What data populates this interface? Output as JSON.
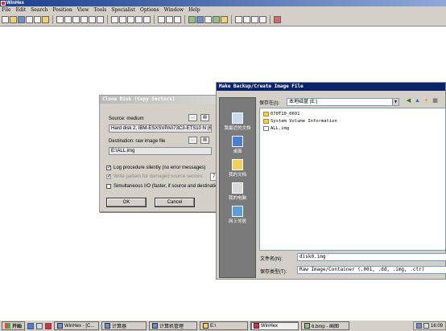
{
  "app": {
    "title": "WinHex"
  },
  "menu": [
    "File",
    "Edit",
    "Search",
    "Position",
    "View",
    "Tools",
    "Specialist",
    "Options",
    "Window",
    "Help"
  ],
  "toolbar_icons": [
    "new-icon",
    "open-icon",
    "save-icon",
    "print-icon",
    "properties-icon",
    "open-folder-icon",
    "undo-icon",
    "cut-icon",
    "copy-icon",
    "paste-icon",
    "paste-special-icon",
    "write-icon",
    "find-icon",
    "find-replace-icon",
    "find-hex-icon",
    "replace-hex-icon",
    "find-integer-icon",
    "goto-offset-icon",
    "back-icon",
    "forward-icon",
    "disk-editor-icon",
    "ram-editor-icon",
    "calculator-icon",
    "hash-icon",
    "data-interpreter-icon",
    "first-sector-icon",
    "previous-sector-icon",
    "next-sector-icon",
    "last-sector-icon",
    "options-icon"
  ],
  "clone_dialog": {
    "title": "Clone Disk (Copy Sectors)",
    "source_label": "Source: medium",
    "source_value": "Hard disk 2, IBM-ESXSVPA073C3-ETS10 N (68.",
    "destination_label": "Destination: raw image file",
    "destination_value": "E:\\ALL.img",
    "log_label": "Log procedure silently (no error messages)",
    "log_checked": true,
    "pattern_label": "Write pattern for damaged source sectors:",
    "pattern_value": "7",
    "pattern_checked": true,
    "simultaneous_label": "Simultaneous I/O (faster, if source and destination",
    "simultaneous_checked": false,
    "ok_label": "OK",
    "cancel_label": "Cancel"
  },
  "save_dialog": {
    "title": "Make Backup/Create Image File",
    "save_in_label": "保存在(I):",
    "save_in_value": "本地磁盘 (E:)",
    "places": [
      {
        "label": "我最近的文档",
        "icon": "recent-documents-icon"
      },
      {
        "label": "桌面",
        "icon": "desktop-icon"
      },
      {
        "label": "我的文档",
        "icon": "my-documents-icon"
      },
      {
        "label": "我的电脑",
        "icon": "my-computer-icon"
      },
      {
        "label": "网上邻居",
        "icon": "network-places-icon"
      }
    ],
    "files": [
      {
        "name": "070T10_0691",
        "type": "folder"
      },
      {
        "name": "System Volume Information",
        "type": "folder"
      },
      {
        "name": "ALL.img",
        "type": "file"
      }
    ],
    "filename_label": "文件名(N):",
    "filename_value": "disk0.img",
    "filetype_label": "保存类型(T):",
    "filetype_value": "Raw Image/Container (.001, .dd, .img, .ctr)"
  },
  "taskbar": {
    "start_label": "开始",
    "tasks": [
      {
        "label": "WinHex - [C..."
      },
      {
        "label": "计算器"
      },
      {
        "label": "计算机管理"
      },
      {
        "label": "E:\\"
      },
      {
        "label": "WinHex"
      },
      {
        "label": "6.bmp - 画图"
      }
    ],
    "clock": "16:09"
  },
  "colors": {
    "title_active": "#0a246a",
    "title_inactive": "#b9b9b9",
    "dialog_bg": "#d4d0c8",
    "places_bg": "#7a7a7a"
  }
}
